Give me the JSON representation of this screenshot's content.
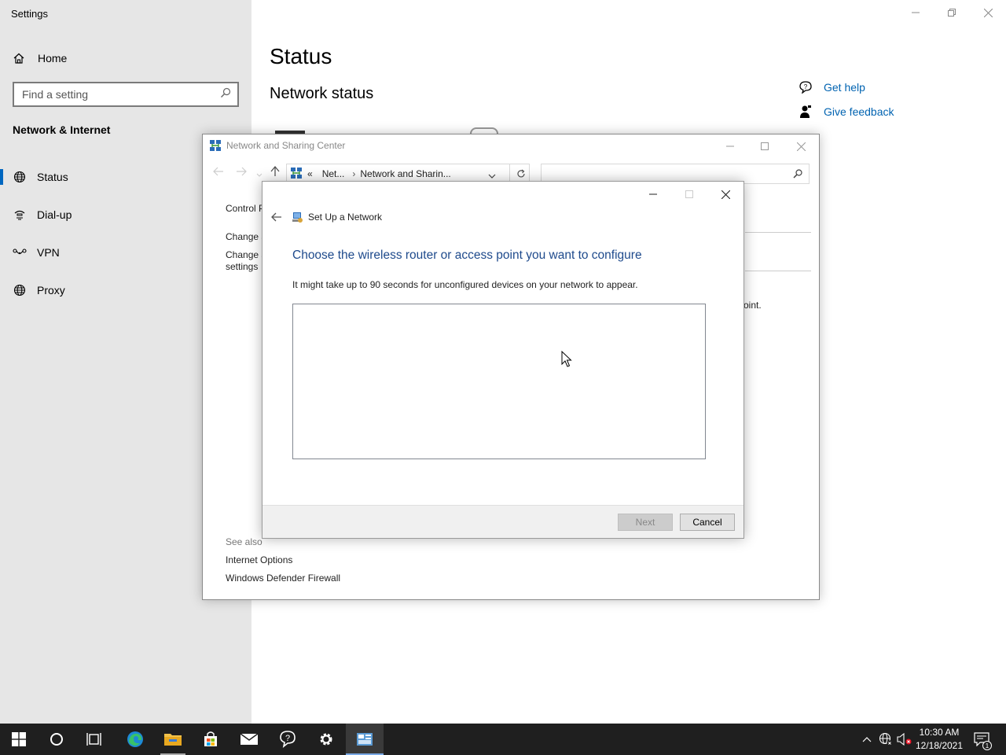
{
  "settings": {
    "app_title": "Settings",
    "home_label": "Home",
    "search_placeholder": "Find a setting",
    "section_title": "Network & Internet",
    "nav_items": [
      {
        "label": "Status",
        "icon": "globe-icon"
      },
      {
        "label": "Dial-up",
        "icon": "dialup-icon"
      },
      {
        "label": "VPN",
        "icon": "vpn-icon"
      },
      {
        "label": "Proxy",
        "icon": "globe-icon"
      }
    ],
    "page_title": "Status",
    "network_status_title": "Network status",
    "help_links": [
      "Get help",
      "Give feedback"
    ]
  },
  "nsc": {
    "title": "Network and Sharing Center",
    "address_segments": [
      "Net...",
      "Network and Sharin..."
    ],
    "side_links": [
      "Control P",
      "Change a",
      "Change a",
      "settings"
    ],
    "see_also_label": "See also",
    "see_also_links": [
      "Internet Options",
      "Windows Defender Firewall"
    ],
    "partial_text": "oint."
  },
  "dialog": {
    "title": "Set Up a Network",
    "heading": "Choose the wireless router or access point you want to configure",
    "description": "It might take up to 90 seconds for unconfigured devices on your network to appear.",
    "next_label": "Next",
    "cancel_label": "Cancel"
  },
  "taskbar": {
    "apps": [
      "start",
      "search",
      "task-view",
      "edge",
      "file-explorer",
      "store",
      "mail",
      "get-help",
      "settings",
      "control-panel"
    ],
    "active_app": "control-panel",
    "time": "10:30 AM",
    "date": "12/18/2021",
    "notification_count": "1"
  },
  "colors": {
    "accent": "#0067c0",
    "link": "#0063b1",
    "heading_blue": "#1e4a8c",
    "taskbar": "#1f1f1f"
  }
}
